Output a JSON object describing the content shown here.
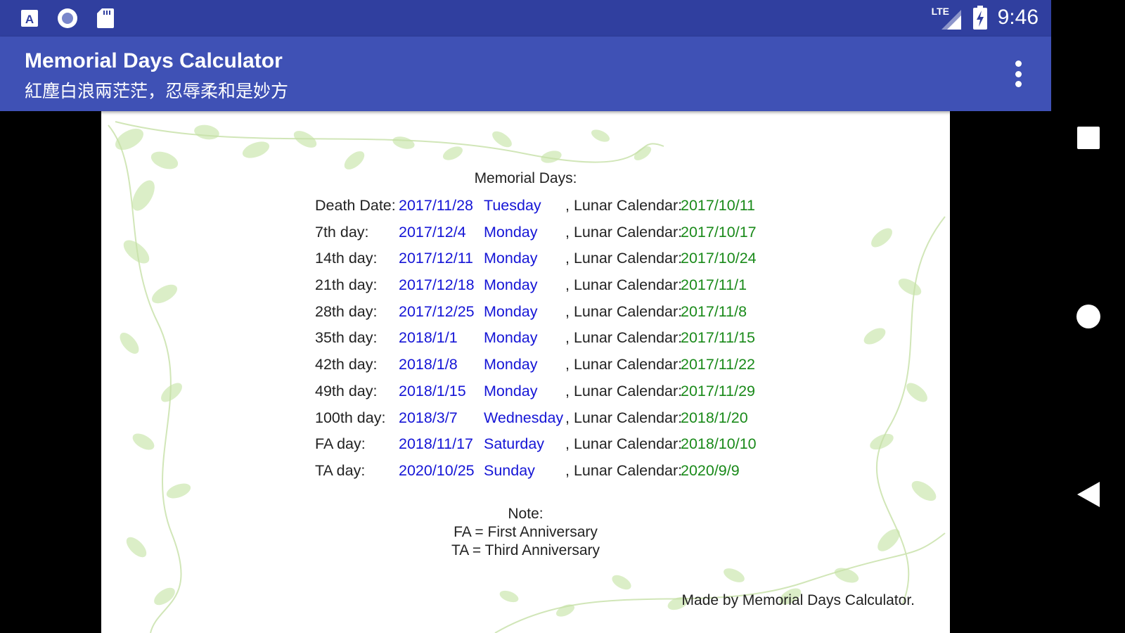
{
  "status_bar": {
    "time": "9:46",
    "network": "LTE",
    "left_icons": [
      "text-a-icon",
      "record-circle-icon",
      "sd-card-icon"
    ],
    "right_icons": [
      "lte-signal-icon",
      "battery-charging-icon"
    ]
  },
  "app_bar": {
    "title": "Memorial Days Calculator",
    "subtitle": "紅塵白浪兩茫茫，忍辱柔和是妙方",
    "background": "#3F51B5",
    "status_background": "#303F9F"
  },
  "content": {
    "heading": "Memorial Days:",
    "lunar_label": ", Lunar Calendar:",
    "rows": [
      {
        "label": "Death Date:",
        "date": "2017/11/28",
        "weekday": "Tuesday",
        "lunar": "2017/10/11"
      },
      {
        "label": "7th day:",
        "date": "2017/12/4",
        "weekday": "Monday",
        "lunar": "2017/10/17"
      },
      {
        "label": "14th day:",
        "date": "2017/12/11",
        "weekday": "Monday",
        "lunar": "2017/10/24"
      },
      {
        "label": "21th day:",
        "date": "2017/12/18",
        "weekday": "Monday",
        "lunar": "2017/11/1"
      },
      {
        "label": "28th day:",
        "date": "2017/12/25",
        "weekday": "Monday",
        "lunar": "2017/11/8"
      },
      {
        "label": "35th day:",
        "date": "2018/1/1",
        "weekday": "Monday",
        "lunar": "2017/11/15"
      },
      {
        "label": "42th day:",
        "date": "2018/1/8",
        "weekday": "Monday",
        "lunar": "2017/11/22"
      },
      {
        "label": "49th day:",
        "date": "2018/1/15",
        "weekday": "Monday",
        "lunar": "2017/11/29"
      },
      {
        "label": "100th day:",
        "date": "2018/3/7",
        "weekday": "Wednesday",
        "lunar": "2018/1/20"
      },
      {
        "label": "FA day:",
        "date": "2018/11/17",
        "weekday": "Saturday",
        "lunar": "2018/10/10"
      },
      {
        "label": "TA day:",
        "date": "2020/10/25",
        "weekday": "Sunday",
        "lunar": "2020/9/9"
      }
    ],
    "note_title": "Note:",
    "note_lines": [
      "FA = First Anniversary",
      "TA = Third Anniversary"
    ],
    "footer": "Made by Memorial Days Calculator.",
    "colors": {
      "date": "#1515d6",
      "lunar": "#1a8a1a",
      "text": "#222222"
    }
  },
  "nav_bar": {
    "buttons": [
      "overview-square-icon",
      "home-circle-icon",
      "back-triangle-icon"
    ]
  }
}
